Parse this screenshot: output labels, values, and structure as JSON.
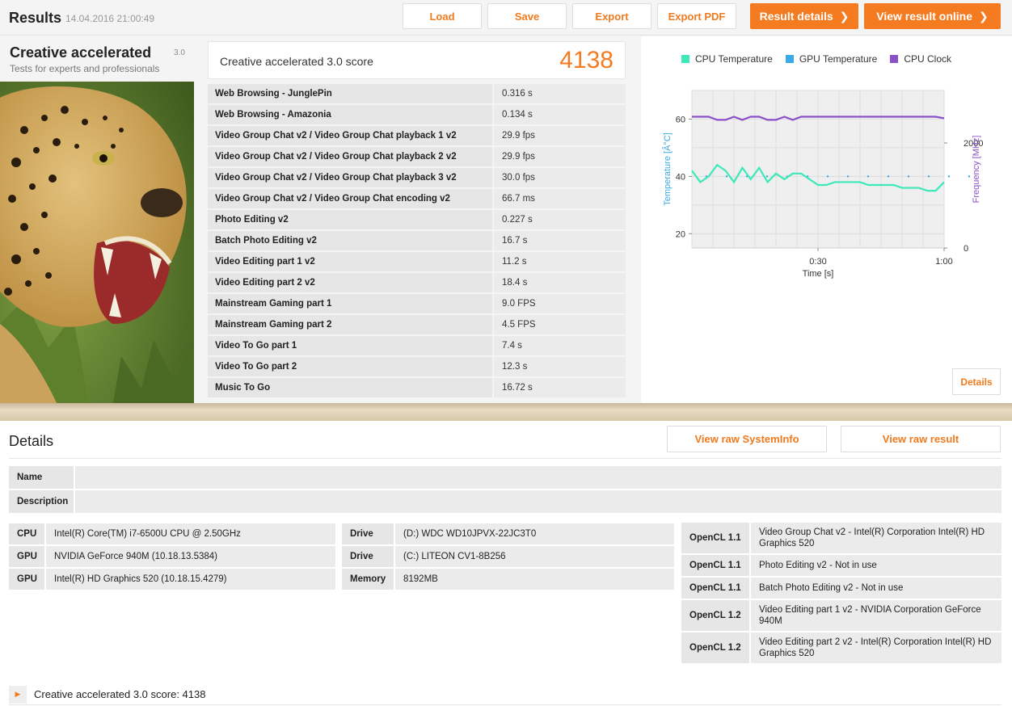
{
  "header": {
    "title": "Results",
    "date": "14.04.2016 21:00:49",
    "buttons": {
      "load": "Load",
      "save": "Save",
      "export": "Export",
      "export_pdf": "Export PDF",
      "result_details": "Result details",
      "view_online": "View result online"
    }
  },
  "benchmark": {
    "name": "Creative accelerated",
    "version": "3.0",
    "subtitle": "Tests for experts and professionals"
  },
  "score": {
    "label": "Creative accelerated 3.0 score",
    "value": "4138"
  },
  "results": [
    {
      "name": "Web Browsing - JunglePin",
      "value": "0.316 s"
    },
    {
      "name": "Web Browsing - Amazonia",
      "value": "0.134 s"
    },
    {
      "name": "Video Group Chat v2 / Video Group Chat playback 1 v2",
      "value": "29.9 fps"
    },
    {
      "name": "Video Group Chat v2 / Video Group Chat playback 2 v2",
      "value": "29.9 fps"
    },
    {
      "name": "Video Group Chat v2 / Video Group Chat playback 3 v2",
      "value": "30.0 fps"
    },
    {
      "name": "Video Group Chat v2 / Video Group Chat encoding v2",
      "value": "66.7 ms"
    },
    {
      "name": "Photo Editing v2",
      "value": "0.227 s"
    },
    {
      "name": "Batch Photo Editing v2",
      "value": "16.7 s"
    },
    {
      "name": "Video Editing part 1 v2",
      "value": "11.2 s"
    },
    {
      "name": "Video Editing part 2 v2",
      "value": "18.4 s"
    },
    {
      "name": "Mainstream Gaming part 1",
      "value": "9.0 FPS"
    },
    {
      "name": "Mainstream Gaming part 2",
      "value": "4.5 FPS"
    },
    {
      "name": "Video To Go part 1",
      "value": "7.4 s"
    },
    {
      "name": "Video To Go part 2",
      "value": "12.3 s"
    },
    {
      "name": "Music To Go",
      "value": "16.72 s"
    }
  ],
  "chart_panel": {
    "details_button": "Details"
  },
  "chart_data": {
    "type": "line",
    "legend": [
      "CPU Temperature",
      "GPU Temperature",
      "CPU Clock"
    ],
    "legend_placement": "top",
    "colors": {
      "cpu_temp": "#3de8b9",
      "gpu_temp": "#3aa9e6",
      "cpu_clock": "#8a4fc9"
    },
    "xlabel": "Time [s]",
    "ylabel_left": "Temperature [Â°C]",
    "ylabel_right": "Frequency [MHz]",
    "xticks": [
      "0:30",
      "1:00"
    ],
    "yticks_left": [
      "20",
      "40",
      "60"
    ],
    "yticks_right": [
      "0",
      "2000"
    ],
    "xlim": [
      0,
      60
    ],
    "ylim_left": [
      15,
      70
    ],
    "ylim_right": [
      0,
      3000
    ],
    "grid": true,
    "series": [
      {
        "name": "CPU Temperature",
        "axis": "left",
        "x": [
          0,
          2,
          4,
          6,
          8,
          10,
          12,
          14,
          16,
          18,
          20,
          22,
          24,
          26,
          28,
          30,
          32,
          34,
          36,
          38,
          40,
          42,
          44,
          46,
          48,
          50,
          52,
          54,
          56,
          58,
          60
        ],
        "y": [
          42,
          38,
          40,
          44,
          42,
          38,
          43,
          39,
          43,
          38,
          41,
          39,
          41,
          41,
          39,
          37,
          37,
          38,
          38,
          38,
          38,
          37,
          37,
          37,
          37,
          36,
          36,
          36,
          35,
          35,
          38
        ]
      },
      {
        "name": "CPU Clock",
        "axis": "right",
        "x": [
          0,
          4,
          6,
          8,
          10,
          12,
          14,
          16,
          18,
          20,
          22,
          24,
          26,
          28,
          30,
          35,
          40,
          45,
          50,
          55,
          58,
          60
        ],
        "y": [
          2500,
          2500,
          2440,
          2440,
          2500,
          2440,
          2500,
          2500,
          2440,
          2440,
          2500,
          2440,
          2500,
          2500,
          2500,
          2500,
          2500,
          2500,
          2500,
          2500,
          2500,
          2470
        ]
      }
    ]
  },
  "details": {
    "title": "Details",
    "btn_sysinfo": "View raw SystemInfo",
    "btn_raw": "View raw result",
    "name_label": "Name",
    "name_value": "",
    "desc_label": "Description",
    "desc_value": "",
    "hardware": [
      {
        "k": "CPU",
        "v": "Intel(R) Core(TM) i7-6500U CPU @ 2.50GHz"
      },
      {
        "k": "GPU",
        "v": "NVIDIA GeForce 940M (10.18.13.5384)"
      },
      {
        "k": "GPU",
        "v": "Intel(R) HD Graphics 520 (10.18.15.4279)"
      }
    ],
    "storage": [
      {
        "k": "Drive",
        "v": "(D:) WDC WD10JPVX-22JC3T0"
      },
      {
        "k": "Drive",
        "v": "(C:) LITEON CV1-8B256"
      },
      {
        "k": "Memory",
        "v": "8192MB"
      }
    ],
    "opencl": [
      {
        "k": "OpenCL 1.1",
        "v": "Video Group Chat v2 - Intel(R) Corporation Intel(R) HD Graphics 520"
      },
      {
        "k": "OpenCL 1.1",
        "v": "Photo Editing v2 - Not in use"
      },
      {
        "k": "OpenCL 1.1",
        "v": "Batch Photo Editing v2 - Not in use"
      },
      {
        "k": "OpenCL 1.2",
        "v": "Video Editing part 1 v2 - NVIDIA Corporation GeForce 940M"
      },
      {
        "k": "OpenCL 1.2",
        "v": "Video Editing part 2 v2 - Intel(R) Corporation Intel(R) HD Graphics 520"
      }
    ],
    "score_expander": "Creative accelerated 3.0 score: 4138"
  }
}
